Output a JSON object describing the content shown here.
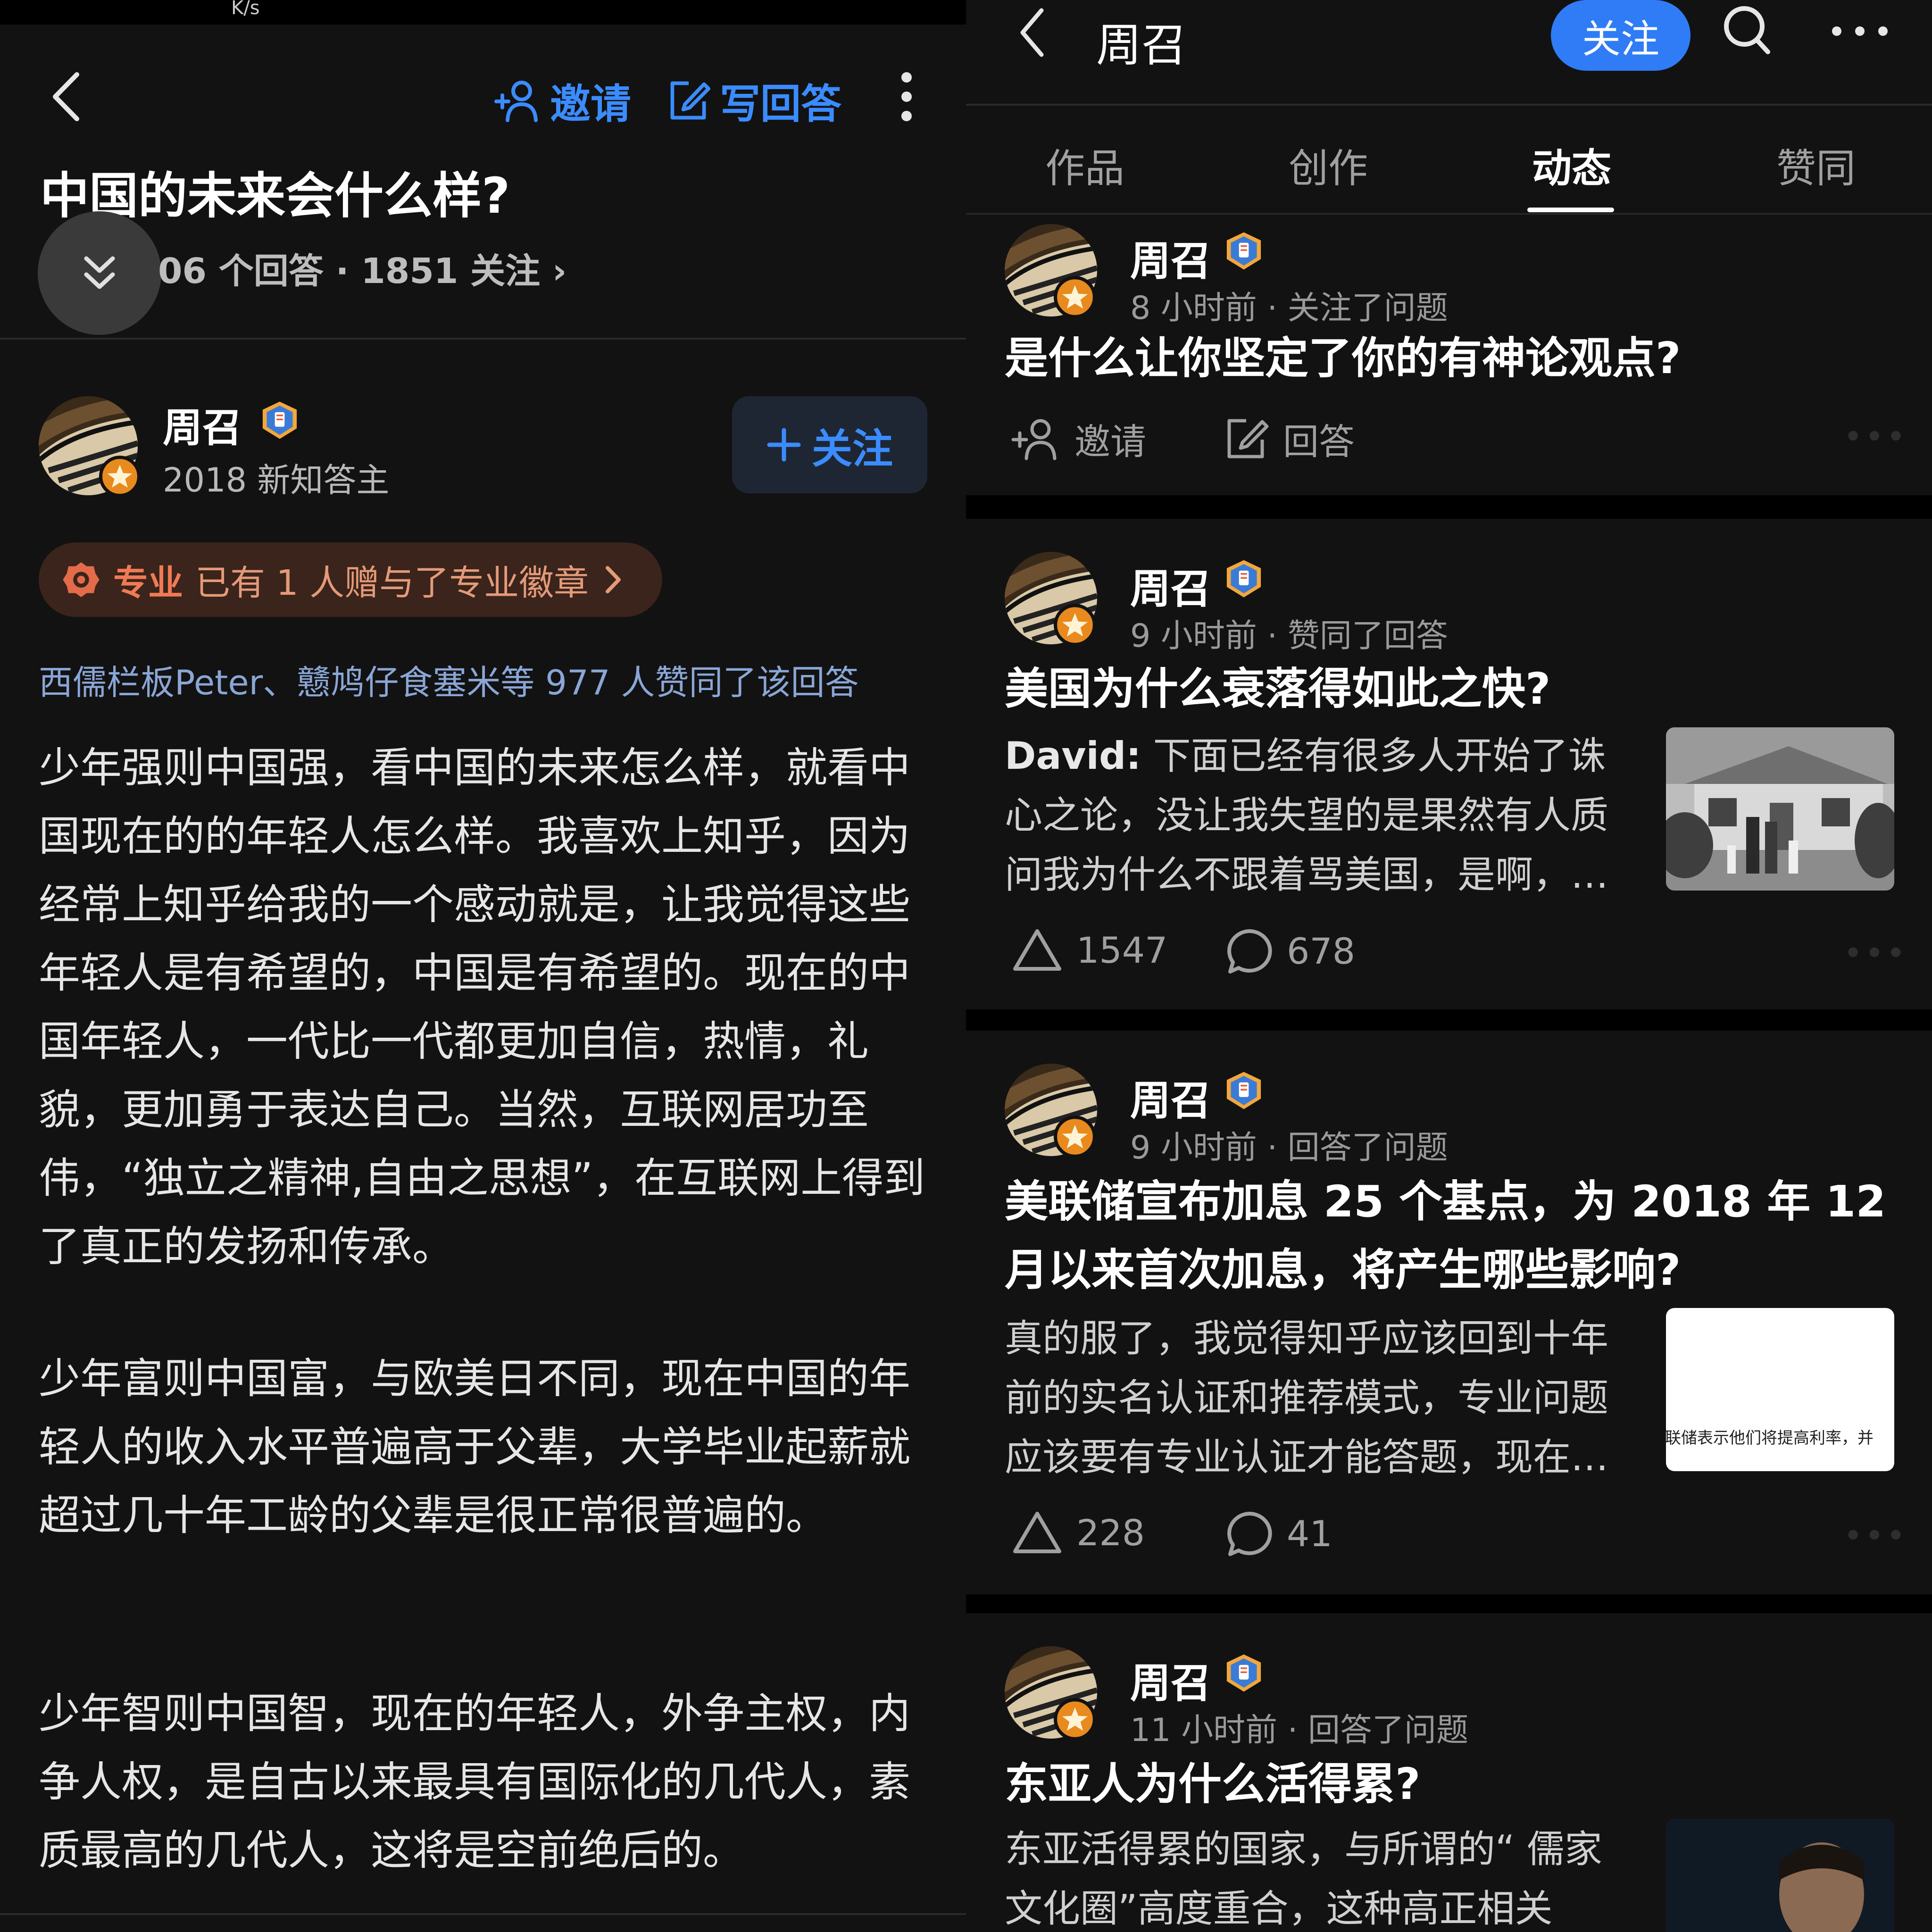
{
  "left": {
    "status_speed": "K/s",
    "toolbar": {
      "invite_label": "邀请",
      "write_answer_label": "写回答"
    },
    "question": {
      "title": "中国的未来会什么样?",
      "stats": "06 个回答 · 1851 关注 ›"
    },
    "author": {
      "name": "周召",
      "subtitle": "2018 新知答主",
      "follow_label": "关注"
    },
    "badge_pill": {
      "tag": "专业",
      "text": "已有 1 人赠与了专业徽章"
    },
    "likers_text": "西儒栏板Peter、戆鸠仔食塞米等 977 人赞同了该回答",
    "answer_paragraphs": [
      "少年强则中国强，看中国的未来怎么样，就看中国现在的的年轻人怎么样。我喜欢上知乎，因为经常上知乎给我的一个感动就是，让我觉得这些年轻人是有希望的，中国是有希望的。现在的中国年轻人，一代比一代都更加自信，热情，礼貌，更加勇于表达自己。当然，互联网居功至伟，“独立之精神,自由之思想”，在互联网上得到了真正的发扬和传承。",
      "少年富则中国富，与欧美日不同，现在中国的年轻人的收入水平普遍高于父辈，大学毕业起薪就超过几十年工龄的父辈是很正常很普遍的。",
      "少年智则中国智，现在的年轻人，外争主权，内争人权，是自古以来最具有国际化的几代人，素质最高的几代人，这将是空前绝后的。"
    ]
  },
  "right": {
    "header": {
      "title": "周召",
      "follow_label": "关注"
    },
    "tabs": [
      "作品",
      "创作",
      "动态",
      "赞同"
    ],
    "active_tab": "动态",
    "feed": [
      {
        "name": "周召",
        "meta": "8 小时前 · 关注了问题",
        "title": "是什么让你坚定了你的有神论观点?",
        "invite_label": "邀请",
        "answer_label": "回答"
      },
      {
        "name": "周召",
        "meta": "9 小时前 · 赞同了回答",
        "title": "美国为什么衰落得如此之快?",
        "excerpt_author": "David:",
        "excerpt": " 下面已经有很多人开始了诛心之论，没让我失望的是果然有人质问我为什么不跟着骂美国，是啊，…",
        "likes": "1547",
        "comments": "678"
      },
      {
        "name": "周召",
        "meta": "9 小时前 · 回答了问题",
        "title": "美联储宣布加息 25 个基点，为 2018 年 12 月以来首次加息，将产生哪些影响?",
        "excerpt": "真的服了，我觉得知乎应该回到十年前的实名认证和推荐模式，专业问题应该要有专业认证才能答题，现在…",
        "thumb_text": "联储表示他们将提高利率，并",
        "likes": "228",
        "comments": "41"
      },
      {
        "name": "周召",
        "meta": "11 小时前 · 回答了问题",
        "title": "东亚人为什么活得累?",
        "excerpt": "东亚活得累的国家，与所谓的“ 儒家文化圈”高度重合，这种高正相关"
      }
    ]
  },
  "colors": {
    "accent": "#3b8cff",
    "follow_bg": "#2f7cf6",
    "bg": "#121212"
  }
}
